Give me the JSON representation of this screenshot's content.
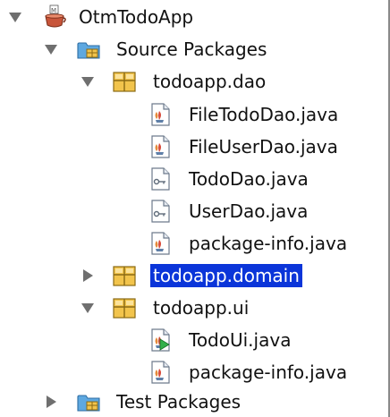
{
  "project": {
    "name": "OtmTodoApp",
    "source_packages": {
      "label": "Source Packages",
      "packages": [
        {
          "name": "todoapp.dao",
          "expanded": true,
          "files": [
            {
              "name": "FileTodoDao.java",
              "icon": "java-class-icon"
            },
            {
              "name": "FileUserDao.java",
              "icon": "java-class-icon"
            },
            {
              "name": "TodoDao.java",
              "icon": "java-interface-icon"
            },
            {
              "name": "UserDao.java",
              "icon": "java-interface-icon"
            },
            {
              "name": "package-info.java",
              "icon": "java-class-icon"
            }
          ]
        },
        {
          "name": "todoapp.domain",
          "expanded": false,
          "selected": true
        },
        {
          "name": "todoapp.ui",
          "expanded": true,
          "files": [
            {
              "name": "TodoUi.java",
              "icon": "java-main-class-icon"
            },
            {
              "name": "package-info.java",
              "icon": "java-class-icon"
            }
          ]
        }
      ]
    },
    "test_packages": {
      "label": "Test Packages",
      "expanded": false
    }
  },
  "colors": {
    "selection_bg": "#0b35d9",
    "selection_text": "#ffffff",
    "package_icon": "#f2c44c",
    "folder_icon": "#5ea8e0",
    "toggle_arrow": "#6f6f6f"
  }
}
